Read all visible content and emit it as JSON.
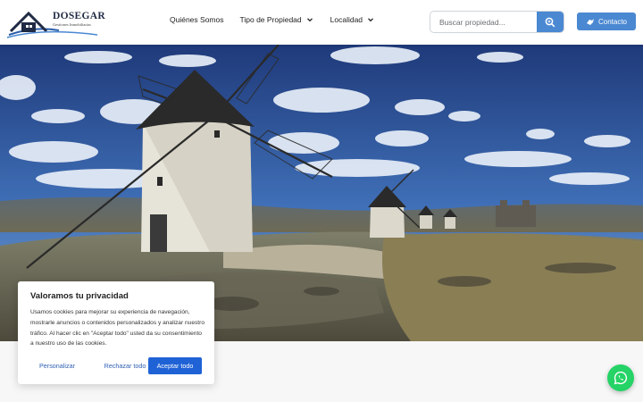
{
  "brand": {
    "name": "DOSEGAR",
    "tagline": "Gestiones Inmobiliarias"
  },
  "nav": {
    "items": [
      {
        "label": "Quiénes Somos",
        "has_dropdown": false
      },
      {
        "label": "Tipo de Propiedad",
        "has_dropdown": true
      },
      {
        "label": "Localidad",
        "has_dropdown": true
      }
    ]
  },
  "search": {
    "placeholder": "Buscar propiedad...",
    "value": ""
  },
  "contact": {
    "label": "Contacto"
  },
  "cookie": {
    "title": "Valoramos tu privacidad",
    "text": "Usamos cookies para mejorar su experiencia de navegación, mostrarle anuncios o contenidos personalizados y analizar nuestro tráfico. Al hacer clic en \"Aceptar todo\" usted da su consentimiento a nuestro uso de las cookies.",
    "customize_label": "Personalizar",
    "reject_label": "Rechazar todo",
    "accept_label": "Aceptar todo"
  },
  "icons": {
    "search": "search-icon",
    "contact": "contact-icon",
    "whatsapp": "whatsapp-icon",
    "dropdown": "chevron-down-icon"
  },
  "colors": {
    "accent": "#4a88d2",
    "accept": "#1f62d6",
    "whatsapp": "#25d366",
    "text": "#222222"
  }
}
